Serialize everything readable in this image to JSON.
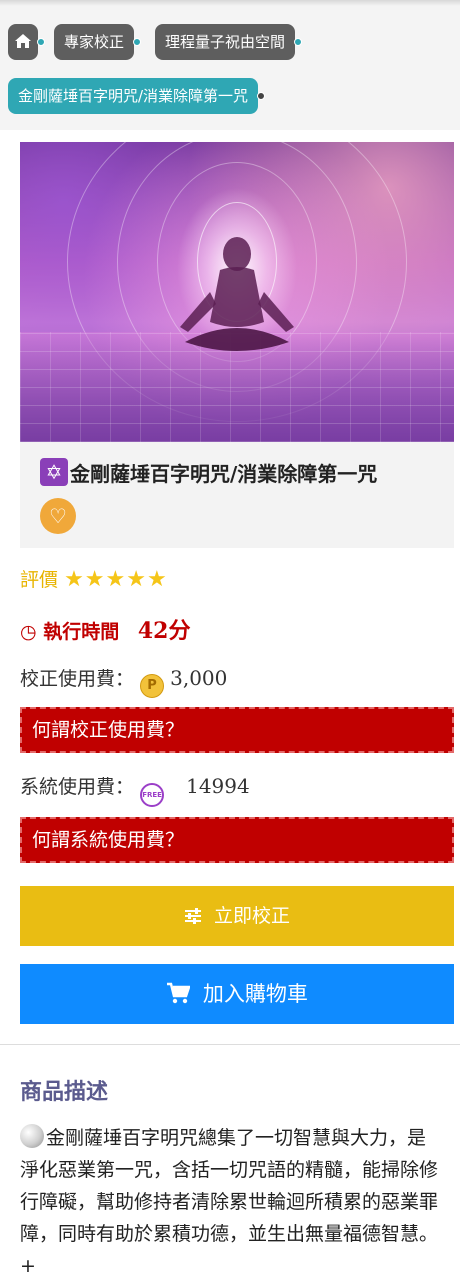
{
  "breadcrumb": {
    "home_icon": "home-icon",
    "items": [
      "專家校正",
      "理程量子祝由空間"
    ],
    "current": "金剛薩埵百字明咒/消業除障第一咒"
  },
  "product": {
    "title_icon": "star-of-david-icon",
    "title": "金剛薩埵百字明咒/消業除障第一咒",
    "favorite_icon": "heart-icon"
  },
  "rating": {
    "label": "評價",
    "stars": 5,
    "stars_text": "★★★★★"
  },
  "execution": {
    "label": "執行時間",
    "value": "42分",
    "icon": "clock-icon"
  },
  "fees": {
    "correction_label": "校正使用費：",
    "correction_value": "3,000",
    "correction_help": "何謂校正使用費？",
    "system_label": "系統使用費：",
    "system_value": "14994",
    "system_help": "何謂系統使用費？"
  },
  "buttons": {
    "correct_now": "立即校正",
    "add_to_cart": "加入購物車"
  },
  "description": {
    "title": "商品描述",
    "body": "金剛薩埵百字明咒總集了一切智慧與大力，是淨化惡業第一咒，含括一切咒語的精髓，能掃除修行障礙，幫助修持者清除累世輪迴所積累的惡業罪障，同時有助於累積功德，並生出無量福德智慧。+"
  },
  "colors": {
    "breadcrumb_dark": "#5e5e5e",
    "breadcrumb_teal": "#2fa7b4",
    "alert_red": "#c00000",
    "gold_button": "#e9bd13",
    "blue_button": "#0f8bff",
    "star": "#f5c518"
  }
}
